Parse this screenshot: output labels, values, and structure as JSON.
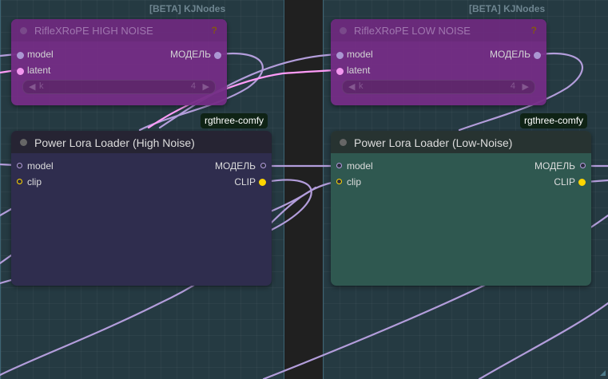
{
  "groups": [
    {
      "title": "[BETA] KJNodes"
    },
    {
      "title": "[BETA] KJNodes"
    }
  ],
  "nodes": {
    "rifle_high": {
      "title": "RifleXRoPE HIGH NOISE",
      "help": "?",
      "inputs": [
        "model",
        "latent"
      ],
      "output": "МОДЕЛЬ",
      "widget": {
        "name": "k",
        "value": "4",
        "left_arrow": "◀",
        "right_arrow": "▶"
      }
    },
    "rifle_low": {
      "title": "RifleXRoPE LOW NOISE",
      "help": "?",
      "inputs": [
        "model",
        "latent"
      ],
      "output": "МОДЕЛЬ",
      "widget": {
        "name": "k",
        "value": "4",
        "left_arrow": "◀",
        "right_arrow": "▶"
      }
    },
    "lora_high": {
      "title": "Power Lora Loader (High Noise)",
      "badge": "rgthree-comfy",
      "inputs": [
        "model",
        "clip"
      ],
      "outputs": [
        "МОДЕЛЬ",
        "CLIP"
      ]
    },
    "lora_low": {
      "title": "Power Lora Loader (Low-Noise)",
      "badge": "rgthree-comfy",
      "inputs": [
        "model",
        "clip"
      ],
      "outputs": [
        "МОДЕЛЬ",
        "CLIP"
      ]
    }
  },
  "colors": {
    "canvas": "#202020",
    "group_fill": "#253a42",
    "group_border": "#3d6474",
    "bypassed_node": "#752d86",
    "lora_high_body": "#2f2d4e",
    "lora_low_body": "#2f5850",
    "model_wire": "#b39ddb",
    "latent_wire": "#ff9cf9",
    "clip_socket": "#ffd500"
  }
}
